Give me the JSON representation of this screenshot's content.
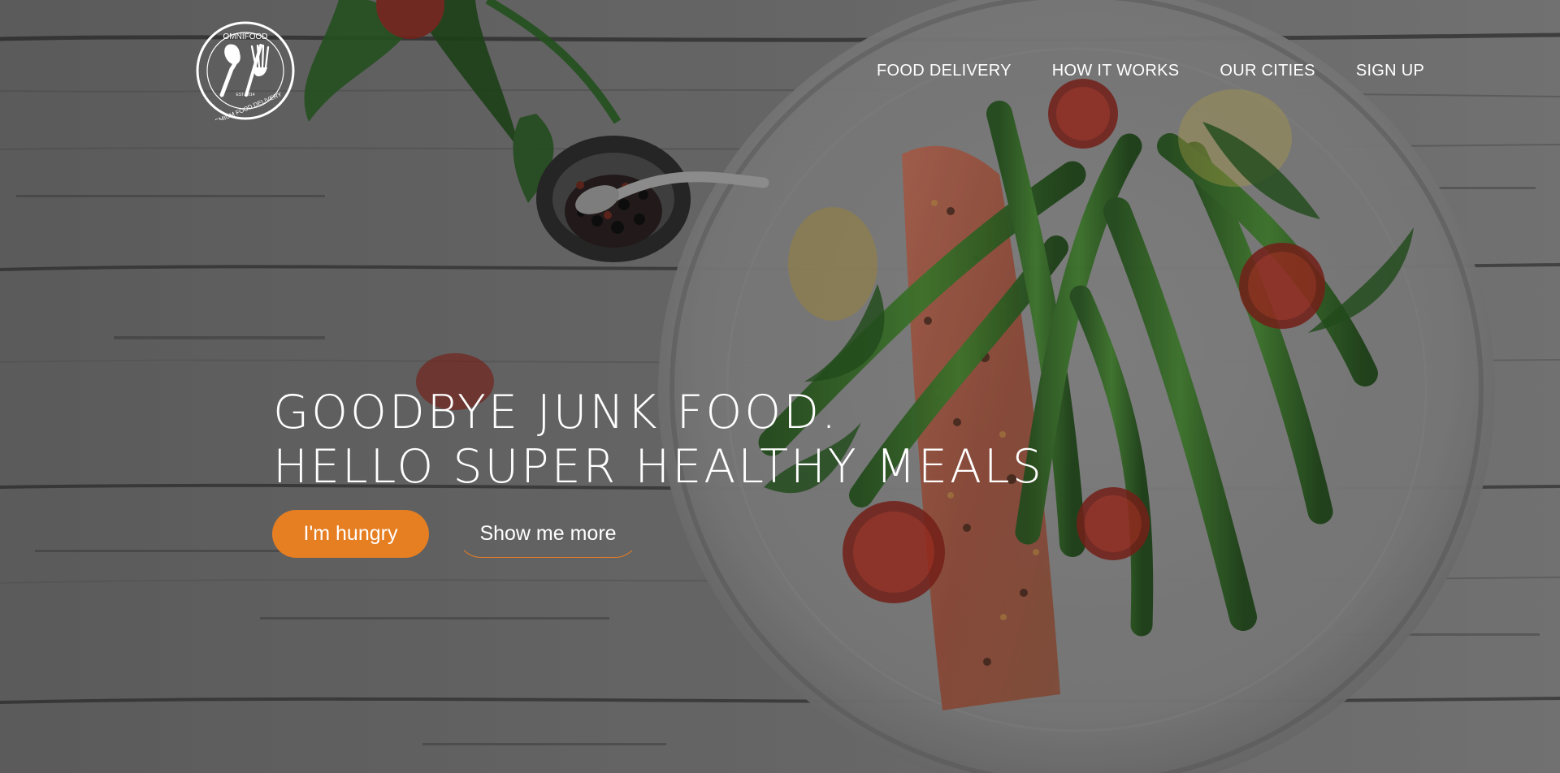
{
  "logo": {
    "top_text": "OMNIFOOD",
    "established": "EST. 2014",
    "bottom_text": "PREMIUM FOOD DELIVERY"
  },
  "nav": {
    "items": [
      {
        "label": "FOOD DELIVERY"
      },
      {
        "label": "HOW IT WORKS"
      },
      {
        "label": "OUR CITIES"
      },
      {
        "label": "SIGN UP"
      }
    ]
  },
  "hero": {
    "headline_line_1": "GOODBYE JUNK FOOD.",
    "headline_line_2": "HELLO SUPER HEALTHY MEALS",
    "primary_button": "I'm hungry",
    "secondary_button": "Show me more"
  },
  "colors": {
    "accent": "#e67e22",
    "text": "#ffffff"
  },
  "icons": {
    "logo": "spoon-and-fork-icon"
  }
}
